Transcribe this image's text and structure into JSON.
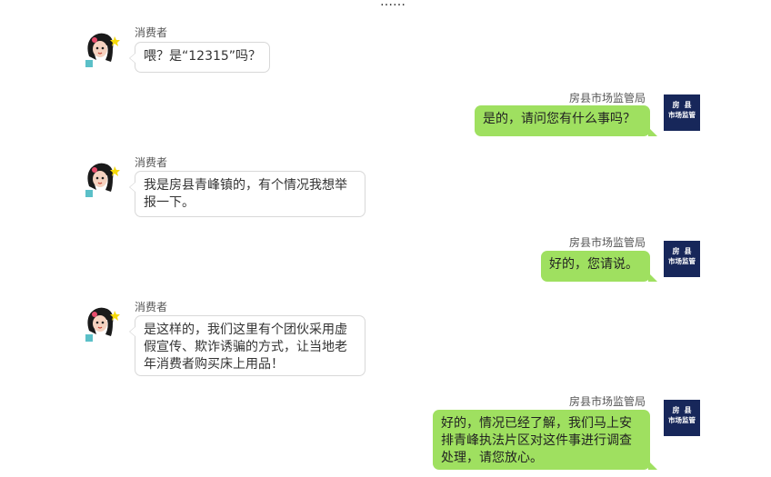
{
  "top_ellipsis": "……",
  "consumer": {
    "name": "消费者"
  },
  "bureau": {
    "name": "房县市场监管局",
    "logo_line1": "房县",
    "logo_line2": "市场监管"
  },
  "messages": [
    {
      "from": "consumer",
      "text": "喂？是“12315”吗？"
    },
    {
      "from": "bureau",
      "text": "是的，请问您有什么事吗？"
    },
    {
      "from": "consumer",
      "text_line1": "我是房县青峰镇的，有个情况我想举",
      "text_line2": "报一下。"
    },
    {
      "from": "bureau",
      "text": "好的，您请说。"
    },
    {
      "from": "consumer",
      "text_line1": "是这样的，我们这里有个团伙采用虚",
      "text_line2": "假宣传、欺诈诱骗的方式，让当地老",
      "text_line3": "年消费者购买床上用品！"
    },
    {
      "from": "bureau",
      "text_line1": "好的，情况已经了解，我们马上安",
      "text_line2": "排青峰执法片区对这件事进行调查",
      "text_line3": "处理，请您放心。"
    }
  ],
  "colors": {
    "bubble_right": "#9fe060",
    "bubble_left_border": "#d8d8d8",
    "logo_bg": "#17275a"
  }
}
